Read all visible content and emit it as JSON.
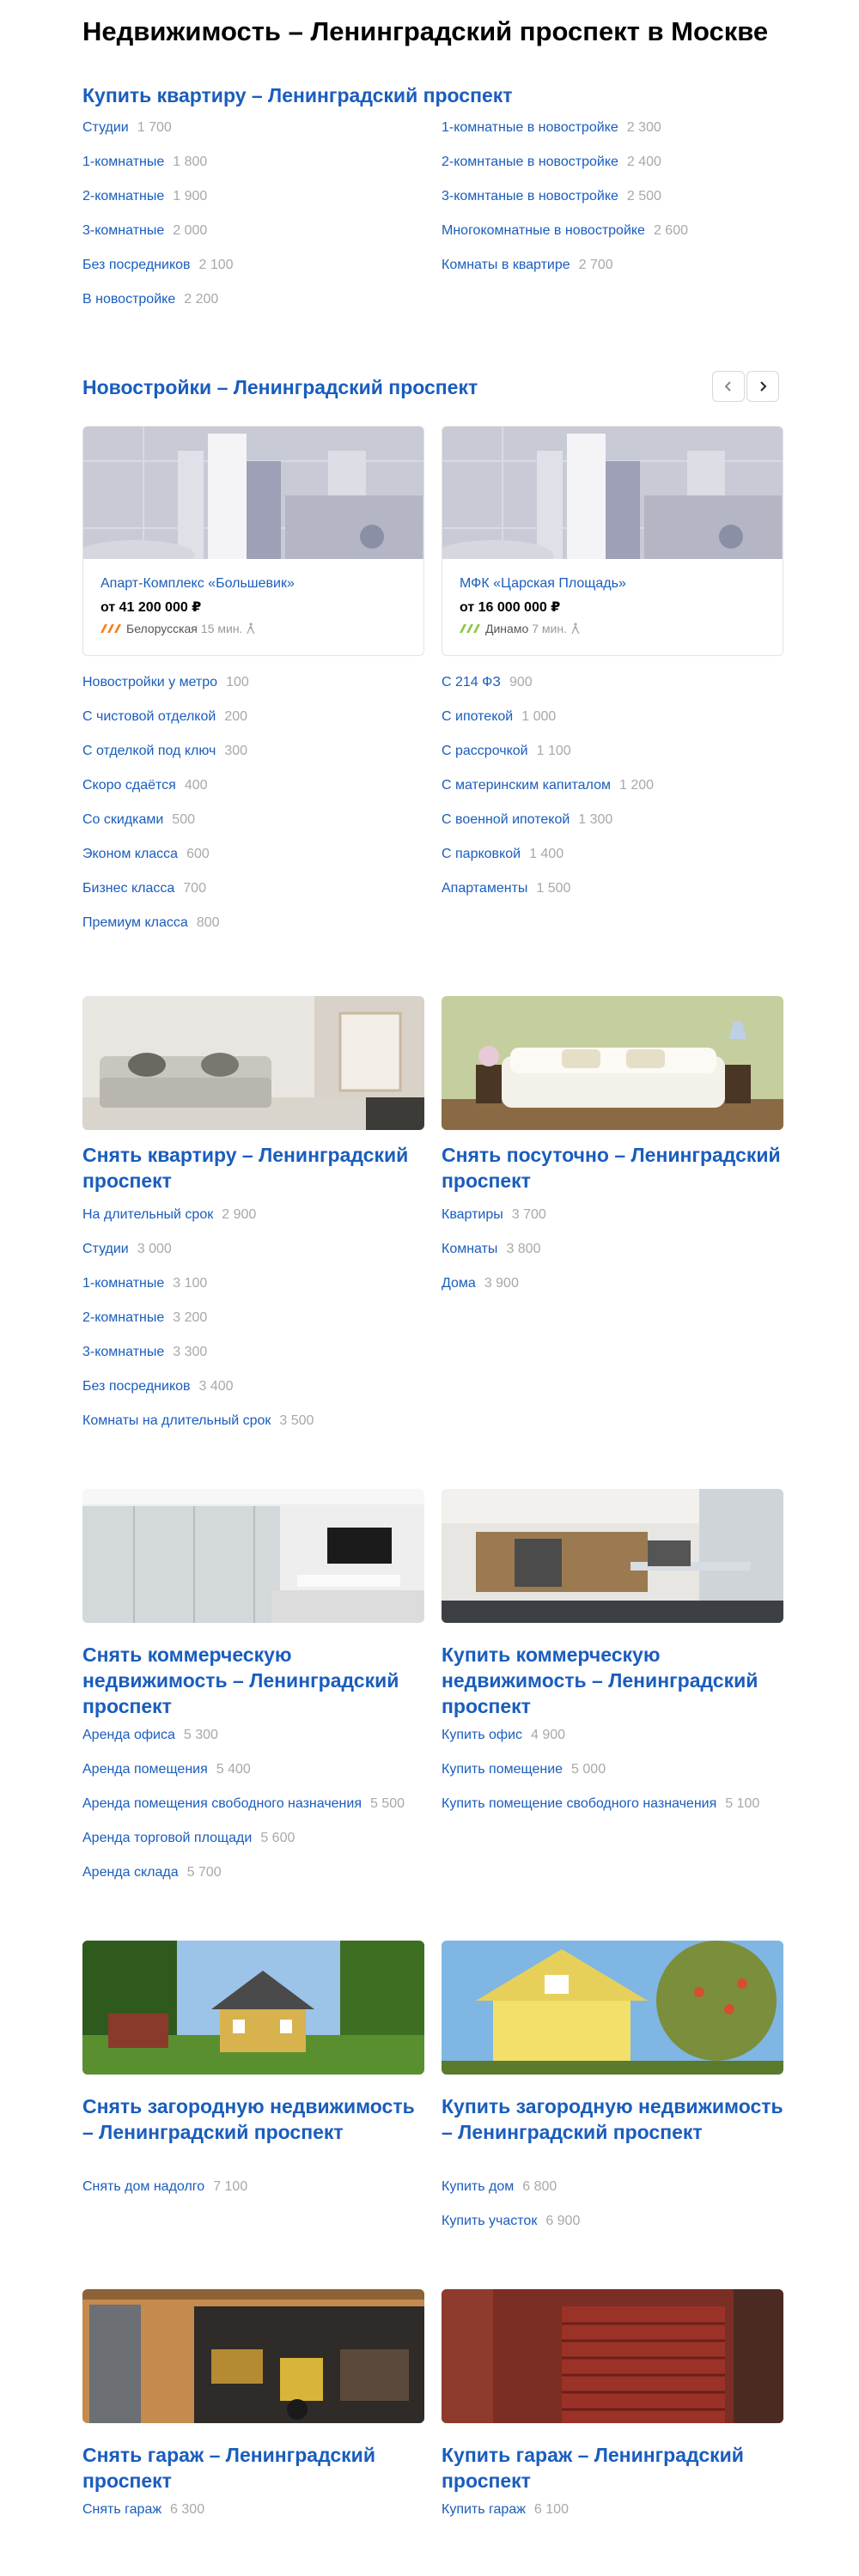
{
  "page": {
    "title": "Недвижимость – Ленинградский проспект в Москве"
  },
  "buy_apartment": {
    "title": "Купить квартиру – Ленинградский проспект",
    "left": [
      {
        "label": "Студии",
        "count": "1 700"
      },
      {
        "label": "1-комнатные",
        "count": "1 800"
      },
      {
        "label": "2-комнатные",
        "count": "1 900"
      },
      {
        "label": "3-комнатные",
        "count": "2 000"
      },
      {
        "label": "Без посредников",
        "count": "2 100"
      },
      {
        "label": "В новостройке",
        "count": "2 200"
      }
    ],
    "right": [
      {
        "label": "1-комнатные в новостройке",
        "count": "2 300"
      },
      {
        "label": "2-комнтаные в новостройке",
        "count": "2 400"
      },
      {
        "label": "3-комнтаные в новостройке",
        "count": "2 500"
      },
      {
        "label": "Многокомнатные в новостройке",
        "count": "2 600"
      },
      {
        "label": "Комнаты в квартире",
        "count": "2 700"
      }
    ]
  },
  "new_buildings": {
    "title": "Новостройки – Ленинградский проспект",
    "cards": [
      {
        "name": "Апарт-Комплекс «Большевик»",
        "price": "от 41 200 000 ₽",
        "metro": "Белорусская",
        "distance": "15 мин.",
        "metro_color": "#f58220"
      },
      {
        "name": "МФК «Царская Площадь»",
        "price": "от 16 000 000 ₽",
        "metro": "Динамо",
        "distance": "7 мин.",
        "metro_color": "#8cc63f"
      }
    ],
    "left": [
      {
        "label": "Новостройки у метро",
        "count": "100"
      },
      {
        "label": "С чистовой отделкой",
        "count": "200"
      },
      {
        "label": "С отделкой под ключ",
        "count": "300"
      },
      {
        "label": "Скоро сдаётся",
        "count": "400"
      },
      {
        "label": "Со скидками",
        "count": "500"
      },
      {
        "label": "Эконом класса",
        "count": "600"
      },
      {
        "label": "Бизнес класса",
        "count": "700"
      },
      {
        "label": "Премиум класса",
        "count": "800"
      }
    ],
    "right": [
      {
        "label": "С 214 ФЗ",
        "count": "900"
      },
      {
        "label": "С ипотекой",
        "count": "1 000"
      },
      {
        "label": "С рассрочкой",
        "count": "1 100"
      },
      {
        "label": "С материнским капиталом",
        "count": "1 200"
      },
      {
        "label": "С военной ипотекой",
        "count": "1 300"
      },
      {
        "label": "С парковкой",
        "count": "1 400"
      },
      {
        "label": "Апартаменты",
        "count": "1 500"
      }
    ]
  },
  "rent_apartment": {
    "title": "Снять квартиру – Ленинградский проспект",
    "items": [
      {
        "label": "На длительный срок",
        "count": "2 900"
      },
      {
        "label": "Студии",
        "count": "3 000"
      },
      {
        "label": "1-комнатные",
        "count": "3 100"
      },
      {
        "label": "2-комнатные",
        "count": "3 200"
      },
      {
        "label": "3-комнатные",
        "count": "3 300"
      },
      {
        "label": "Без посредников",
        "count": "3 400"
      },
      {
        "label": "Комнаты на длительный срок",
        "count": "3 500"
      }
    ]
  },
  "rent_daily": {
    "title": "Снять посуточно – Ленинградский проспект",
    "items": [
      {
        "label": "Квартиры",
        "count": "3 700"
      },
      {
        "label": "Комнаты",
        "count": "3 800"
      },
      {
        "label": "Дома",
        "count": "3 900"
      }
    ]
  },
  "rent_commercial": {
    "title": "Снять коммерческую недвижимость – Ленинградский проспект",
    "items": [
      {
        "label": "Аренда офиса",
        "count": "5 300"
      },
      {
        "label": "Аренда помещения",
        "count": "5 400"
      },
      {
        "label": "Аренда помещения свободного назначения",
        "count": "5 500"
      },
      {
        "label": "Аренда торговой площади",
        "count": "5 600"
      },
      {
        "label": "Аренда склада",
        "count": "5 700"
      }
    ]
  },
  "buy_commercial": {
    "title": "Купить коммерческую недвижимость – Ленинградский проспект",
    "items": [
      {
        "label": "Купить офис",
        "count": "4 900"
      },
      {
        "label": "Купить помещение",
        "count": "5 000"
      },
      {
        "label": "Купить помещение свободного назначения",
        "count": "5 100"
      }
    ]
  },
  "rent_country": {
    "title": "Снять загородную недвижимость – Ленинградский проспект",
    "items": [
      {
        "label": "Снять дом надолго",
        "count": "7 100"
      }
    ]
  },
  "buy_country": {
    "title": "Купить загородную недвижимость – Ленинградский проспект",
    "items": [
      {
        "label": "Купить дом",
        "count": "6 800"
      },
      {
        "label": "Купить участок",
        "count": "6 900"
      }
    ]
  },
  "rent_garage": {
    "title": "Снять гараж – Ленинградский проспект",
    "items": [
      {
        "label": "Снять гараж",
        "count": "6 300"
      }
    ]
  },
  "buy_garage": {
    "title": "Купить гараж – Ленинградский проспект",
    "items": [
      {
        "label": "Купить гараж",
        "count": "6 100"
      }
    ]
  },
  "icons": {
    "prev": "chevron-left-icon",
    "next": "chevron-right-icon",
    "walk": "walking-person-icon",
    "metro": "metro-line-icon"
  }
}
